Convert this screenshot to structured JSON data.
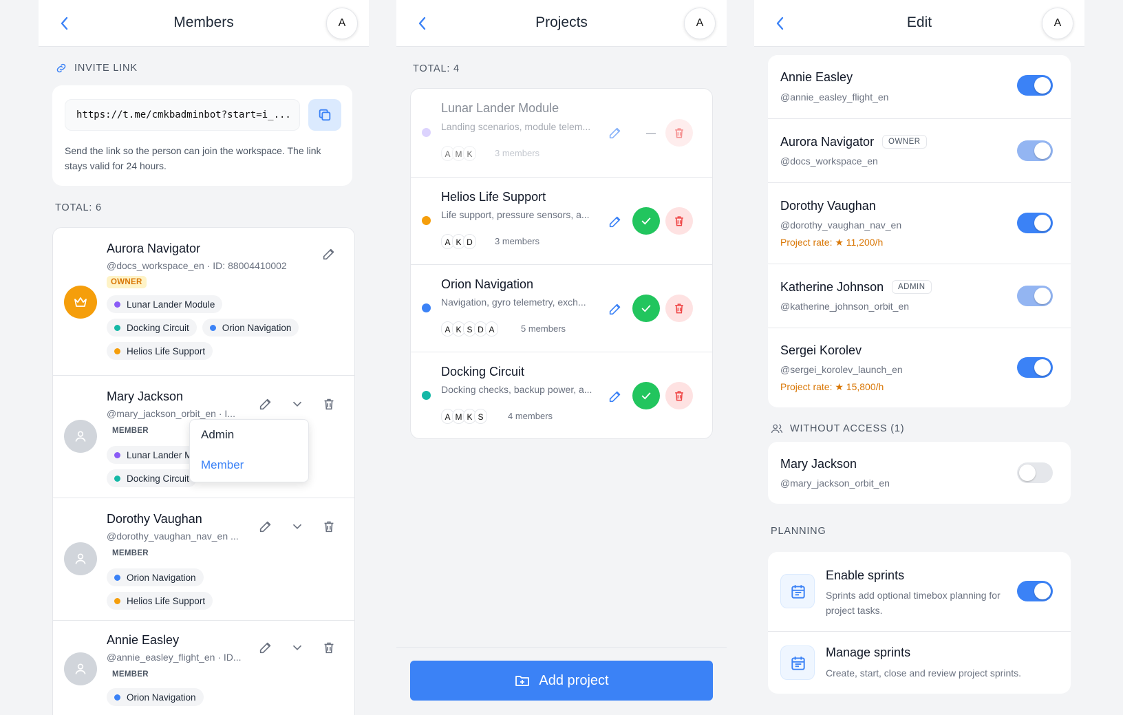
{
  "members_panel": {
    "title": "Members",
    "avatar_letter": "A",
    "invite_section_label": "INVITE LINK",
    "invite_url": "https://t.me/cmkbadminbot?start=i_...",
    "invite_hint": "Send the link so the person can join the workspace. The link stays valid for 24 hours.",
    "total_label": "TOTAL: 6",
    "members": [
      {
        "name": "Aurora Navigator",
        "handle": "@docs_workspace_en · ID: 88004410002",
        "role": "OWNER",
        "projects": [
          "Lunar Lander Module",
          "Docking Circuit",
          "Orion Navigation",
          "Helios Life Support"
        ]
      },
      {
        "name": "Mary Jackson",
        "handle": "@mary_jackson_orbit_en · I...",
        "role": "MEMBER",
        "projects": [
          "Lunar Lander M",
          "Docking Circuit"
        ]
      },
      {
        "name": "Dorothy Vaughan",
        "handle": "@dorothy_vaughan_nav_en ...",
        "role": "MEMBER",
        "projects": [
          "Orion Navigation",
          "Helios Life Support"
        ]
      },
      {
        "name": "Annie Easley",
        "handle": "@annie_easley_flight_en · ID...",
        "role": "MEMBER",
        "projects": [
          "Orion Navigation"
        ]
      }
    ],
    "role_dropdown": {
      "options": [
        "Admin",
        "Member"
      ],
      "selected": "Member"
    }
  },
  "projects_panel": {
    "title": "Projects",
    "avatar_letter": "A",
    "total_label": "TOTAL: 4",
    "projects": [
      {
        "name": "Lunar Lander Module",
        "desc": "Landing scenarios, module telem...",
        "letters": [
          "A",
          "M",
          "K"
        ],
        "members": "3 members",
        "color": "#c4b5fd",
        "active": false
      },
      {
        "name": "Helios Life Support",
        "desc": "Life support, pressure sensors, a...",
        "letters": [
          "A",
          "K",
          "D"
        ],
        "members": "3 members",
        "color": "#f59e0b",
        "active": true
      },
      {
        "name": "Orion Navigation",
        "desc": "Navigation, gyro telemetry, exch...",
        "letters": [
          "A",
          "K",
          "S",
          "D",
          "A"
        ],
        "members": "5 members",
        "color": "#3b82f6",
        "active": true
      },
      {
        "name": "Docking Circuit",
        "desc": "Docking checks, backup power, a...",
        "letters": [
          "A",
          "M",
          "K",
          "S"
        ],
        "members": "4 members",
        "color": "#14b8a6",
        "active": true
      }
    ],
    "add_button": "Add project"
  },
  "edit_panel": {
    "title": "Edit",
    "avatar_letter": "A",
    "users": [
      {
        "name": "Annie Easley",
        "handle": "@annie_easley_flight_en",
        "badge": "",
        "rate": "",
        "toggle": "on"
      },
      {
        "name": "Aurora Navigator",
        "handle": "@docs_workspace_en",
        "badge": "OWNER",
        "rate": "",
        "toggle": "dim"
      },
      {
        "name": "Dorothy Vaughan",
        "handle": "@dorothy_vaughan_nav_en",
        "badge": "",
        "rate": "Project rate: ★ 11,200/h",
        "toggle": "on"
      },
      {
        "name": "Katherine Johnson",
        "handle": "@katherine_johnson_orbit_en",
        "badge": "ADMIN",
        "rate": "",
        "toggle": "dim"
      },
      {
        "name": "Sergei Korolev",
        "handle": "@sergei_korolev_launch_en",
        "badge": "",
        "rate": "Project rate: ★ 15,800/h",
        "toggle": "on"
      }
    ],
    "without_access_label": "WITHOUT ACCESS (1)",
    "without_access": [
      {
        "name": "Mary Jackson",
        "handle": "@mary_jackson_orbit_en",
        "toggle": "off"
      }
    ],
    "planning_label": "PLANNING",
    "planning": [
      {
        "title": "Enable sprints",
        "desc": "Sprints add optional timebox planning for project tasks.",
        "toggle": "on"
      },
      {
        "title": "Manage sprints",
        "desc": "Create, start, close and review project sprints."
      }
    ]
  },
  "colors": {
    "accent": "#3b82f6",
    "success": "#22c55e",
    "danger": "#ef4444",
    "owner": "#f59e0b",
    "rate": "#d97706"
  }
}
